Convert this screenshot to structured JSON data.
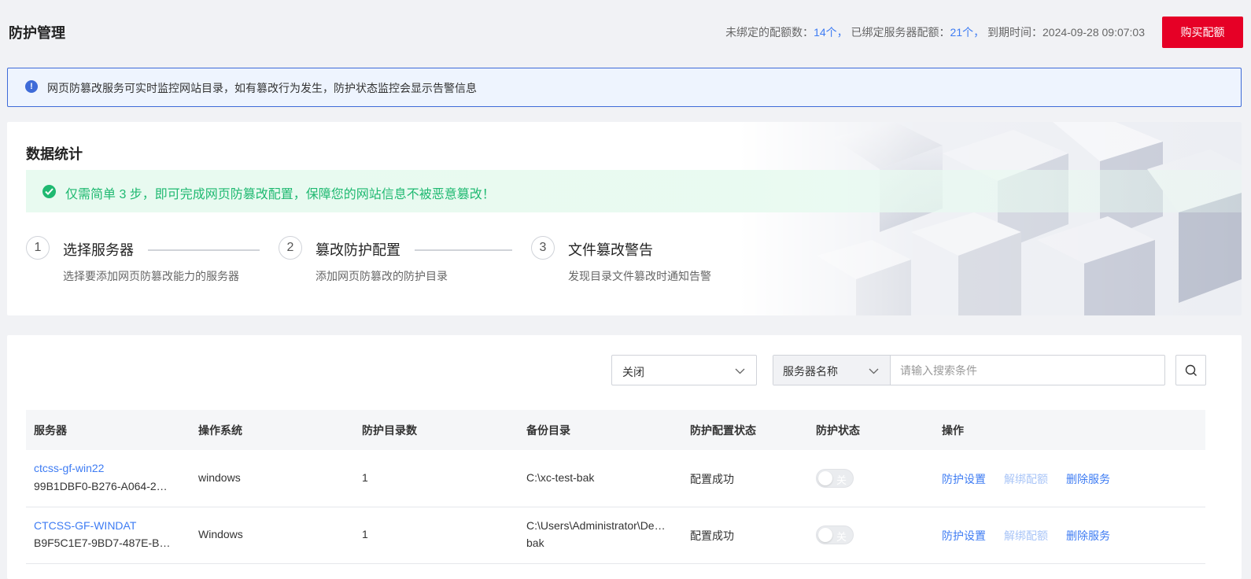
{
  "header": {
    "title": "防护管理",
    "unbound_label": "未绑定的配额数：",
    "unbound_value": "14个，",
    "bound_label": "已绑定服务器配额：",
    "bound_value": "21个，",
    "expire_label": "到期时间：",
    "expire_value": "2024-09-28 09:07:03",
    "buy_button": "购买配额"
  },
  "notice": {
    "text": "网页防篡改服务可实时监控网站目录，如有篡改行为发生，防护状态监控会显示告警信息"
  },
  "stats": {
    "title": "数据统计",
    "tip": "仅需简单 3 步，即可完成网页防篡改配置，保障您的网站信息不被恶意篡改！",
    "steps": [
      {
        "num": "1",
        "title": "选择服务器",
        "desc": "选择要添加网页防篡改能力的服务器"
      },
      {
        "num": "2",
        "title": "篡改防护配置",
        "desc": "添加网页防篡改的防护目录"
      },
      {
        "num": "3",
        "title": "文件篡改警告",
        "desc": "发现目录文件篡改时通知告警"
      }
    ]
  },
  "filters": {
    "status_value": "关闭",
    "search_type": "服务器名称",
    "search_placeholder": "请输入搜索条件"
  },
  "table": {
    "columns": [
      "服务器",
      "操作系统",
      "防护目录数",
      "备份目录",
      "防护配置状态",
      "防护状态",
      "操作"
    ],
    "rows": [
      {
        "name": "ctcss-gf-win22",
        "id": "99B1DBF0-B276-A064-2…",
        "os": "windows",
        "dir_count": "1",
        "backup_line1": "C:\\xc-test-bak",
        "backup_line2": "",
        "config_status": "配置成功",
        "protect_state": "关",
        "op_settings": "防护设置",
        "op_unbind": "解绑配额",
        "op_delete": "删除服务"
      },
      {
        "name": "CTCSS-GF-WINDAT",
        "id": "B9F5C1E7-9BD7-487E-B…",
        "os": "Windows",
        "dir_count": "1",
        "backup_line1": "C:\\Users\\Administrator\\De…",
        "backup_line2": "bak",
        "config_status": "配置成功",
        "protect_state": "关",
        "op_settings": "防护设置",
        "op_unbind": "解绑配额",
        "op_delete": "删除服务"
      }
    ]
  },
  "colors": {
    "accent": "#3e7cf3",
    "buy": "#e60026",
    "success": "#1fb971"
  }
}
